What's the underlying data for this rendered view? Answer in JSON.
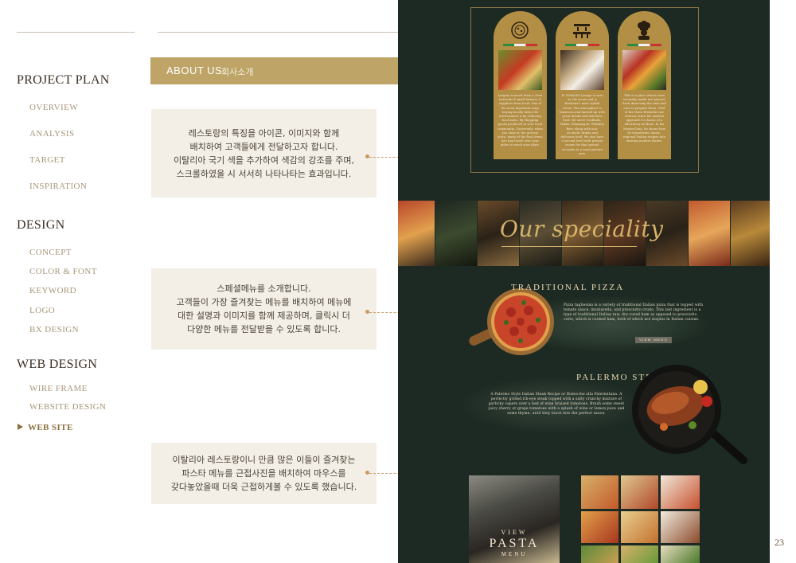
{
  "sidebar": {
    "sections": [
      {
        "title": "PROJECT PLAN",
        "items": [
          "OVERVIEW",
          "ANALYSIS",
          "TARGET",
          "INSPIRATION"
        ]
      },
      {
        "title": "DESIGN",
        "items": [
          "CONCEPT",
          "COLOR & FONT",
          "KEYWORD",
          "LOGO",
          "BX DESIGN"
        ]
      },
      {
        "title": "WEB DESIGN",
        "items": [
          "WIRE FRAME",
          "WEBSITE DESIGN",
          "WEB SITE"
        ]
      }
    ],
    "active_item": "WEB SITE"
  },
  "about": {
    "label_en": "ABOUT US",
    "label_ko": "회사소개"
  },
  "descriptions": [
    "레스토랑의 특징을 아이콘, 이미지와 함께\n배치하여 고객들에게 전달하고자 합니다.\n이탈리아 국기 색을 추가하여 색감의 강조를 주며,\n스크롤하였을 시 서서히 나타나타는 효과입니다.",
    "스페셜메뉴를 소개합니다.\n고객들이 가장 즐겨찾는 메뉴를 배치하여 메뉴에\n대한 설명과 이미지를 함께 제공하며, 클릭시 더\n다양한 메뉴를 전달받을 수 있도록 합니다.",
    "이탈리아 레스토랑이니 만큼 많은 이들이 즐겨찾는\n파스타 메뉴를 근접사진을 배치하여 마우스를\n갖다놓았을때 더욱 근접하게볼 수 있도록 했습니다."
  ],
  "mockup": {
    "cards": [
      {
        "icon": "pizza-logo-icon",
        "text": "Largely sourced from a close network of small farmers & suppliers from local. One of the most important ways buying locally helps the environment is by reducing food miles. By shopping goods produced in your local community. Conversely, when you shop at the grocery store, many of the food items you buy travel over your miles to reach your plate."
      },
      {
        "icon": "bar-counter-icon",
        "text": "IL DOMANI Lounge is now on the scene and is Brisbane's most stylish venue. The atmosphere is luxurious and backed up with great drinks and delicious food. We serve Cocktails, Vodka, Champagne, Whiskey, Beer along with non-alcoholic drinks and delicious food. We also have a second level with private rooms for that special occasion in a more private area."
      },
      {
        "icon": "chef-icon",
        "text": "This is a place where even everyday meals are special. Each deserving the time and care to prepare them. Chef of the three-Michelin-star Osteria, learn his modern approach to classic of a laboratory of ideas. In his MasterClass, he shows how he transforms classic, regional Italian recipes into exciting modern dishes."
      }
    ],
    "speciality_title": "Our speciality",
    "dishes": [
      {
        "title": "TRADITIONAL PIZZA",
        "desc": "Pizza tagliesina is a variety of traditional Italian pizza that is topped with tomato sauce, mozzarella, and prosciutto crudo. This last ingredient is a type of traditional Italian raw, dry-cured ham as opposed to prosciutto cotto, which is cooked ham, both of which are staples in Italian cuisine.",
        "button": "VIEW MENU"
      },
      {
        "title": "PALERMO STEAK",
        "desc": "A Palermo Style Italian Steak Recipe or Bistecche alla Palermitana. A perfectly grilled rib-eye steak topped with a salty crunchy mixture of garlicky capers over a bed of wine braised tomatoes. Brush some sweet juicy cherry or grape tomatoes with a splash of wine or lemon juice and some thyme, until they burst into the perfect sauce."
      }
    ],
    "pasta": {
      "view": "VIEW",
      "title": "PASTA",
      "menu": "MENU"
    }
  },
  "page_number": "23",
  "colors": {
    "gold": "#bea567",
    "dark_green": "#1d2a23",
    "sidebar_text": "#a8967a",
    "desc_bg": "#f3efe7"
  }
}
